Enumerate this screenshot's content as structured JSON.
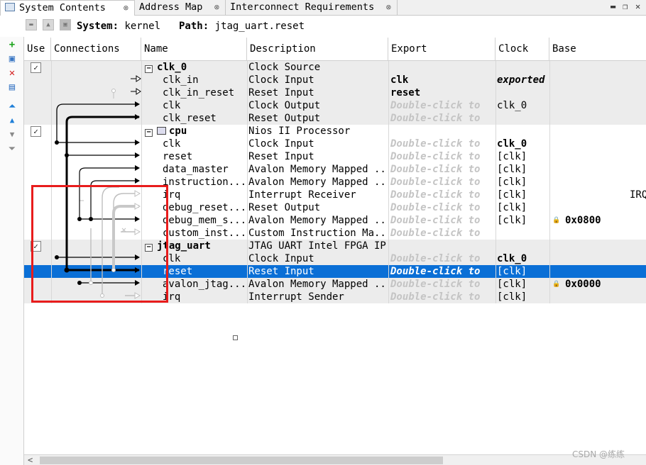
{
  "tabs": [
    {
      "label": "System Contents",
      "close": "⊗"
    },
    {
      "label": "Address Map",
      "close": "⊗"
    },
    {
      "label": "Interconnect Requirements",
      "close": "⊗"
    }
  ],
  "window_controls": {
    "minimize": "▬",
    "restore": "❐",
    "close": "✕"
  },
  "path_bar": {
    "system_label": "System:",
    "system_value": "kernel",
    "path_label": "Path:",
    "path_value": "jtag_uart.reset"
  },
  "columns": {
    "use": "Use",
    "connections": "Connections",
    "name": "Name",
    "description": "Description",
    "export": "Export",
    "clock": "Clock",
    "base": "Base"
  },
  "rows": [
    {
      "name": "clk_0",
      "desc": "Clock Source",
      "export": "",
      "clock": "",
      "base": "",
      "extra": ""
    },
    {
      "name": "clk_in",
      "desc": "Clock Input",
      "export": "clk",
      "clock": "exported",
      "base": "",
      "extra": ""
    },
    {
      "name": "clk_in_reset",
      "desc": "Reset Input",
      "export": "reset",
      "clock": "",
      "base": "",
      "extra": ""
    },
    {
      "name": "clk",
      "desc": "Clock Output",
      "export": "Double-click to",
      "clock": "clk_0",
      "base": "",
      "extra": ""
    },
    {
      "name": "clk_reset",
      "desc": "Reset Output",
      "export": "Double-click to",
      "clock": "",
      "base": "",
      "extra": ""
    },
    {
      "name": "cpu",
      "desc": "Nios II Processor",
      "export": "",
      "clock": "",
      "base": "",
      "extra": ""
    },
    {
      "name": "clk",
      "desc": "Clock Input",
      "export": "Double-click to",
      "clock": "clk_0",
      "base": "",
      "extra": ""
    },
    {
      "name": "reset",
      "desc": "Reset Input",
      "export": "Double-click to",
      "clock": "[clk]",
      "base": "",
      "extra": ""
    },
    {
      "name": "data_master",
      "desc": "Avalon Memory Mapped ...",
      "export": "Double-click to",
      "clock": "[clk]",
      "base": "",
      "extra": ""
    },
    {
      "name": "instruction...",
      "desc": "Avalon Memory Mapped ...",
      "export": "Double-click to",
      "clock": "[clk]",
      "base": "",
      "extra": ""
    },
    {
      "name": "irq",
      "desc": "Interrupt Receiver",
      "export": "Double-click to",
      "clock": "[clk]",
      "base": "",
      "extra": "IRQ"
    },
    {
      "name": "debug_reset...",
      "desc": "Reset Output",
      "export": "Double-click to",
      "clock": "[clk]",
      "base": "",
      "extra": ""
    },
    {
      "name": "debug_mem_s...",
      "desc": "Avalon Memory Mapped ...",
      "export": "Double-click to",
      "clock": "[clk]",
      "base": "0x0800",
      "extra": ""
    },
    {
      "name": "custom_inst...",
      "desc": "Custom Instruction Ma...",
      "export": "Double-click to",
      "clock": "",
      "base": "",
      "extra": ""
    },
    {
      "name": "jtag_uart",
      "desc": "JTAG UART Intel FPGA IP",
      "export": "",
      "clock": "",
      "base": "",
      "extra": ""
    },
    {
      "name": "clk",
      "desc": "Clock Input",
      "export": "Double-click to",
      "clock": "clk_0",
      "base": "",
      "extra": ""
    },
    {
      "name": "reset",
      "desc": "Reset Input",
      "export": "Double-click to",
      "clock": "[clk]",
      "base": "",
      "extra": ""
    },
    {
      "name": "avalon_jtag...",
      "desc": "Avalon Memory Mapped ...",
      "export": "Double-click to",
      "clock": "[clk]",
      "base": "0x0000",
      "extra": ""
    },
    {
      "name": "irq",
      "desc": "Interrupt Sender",
      "export": "Double-click to",
      "clock": "[clk]",
      "base": "",
      "extra": ""
    }
  ],
  "checkbox_mark": "✓",
  "expander_mark": "−",
  "watermark": "CSDN @练练"
}
